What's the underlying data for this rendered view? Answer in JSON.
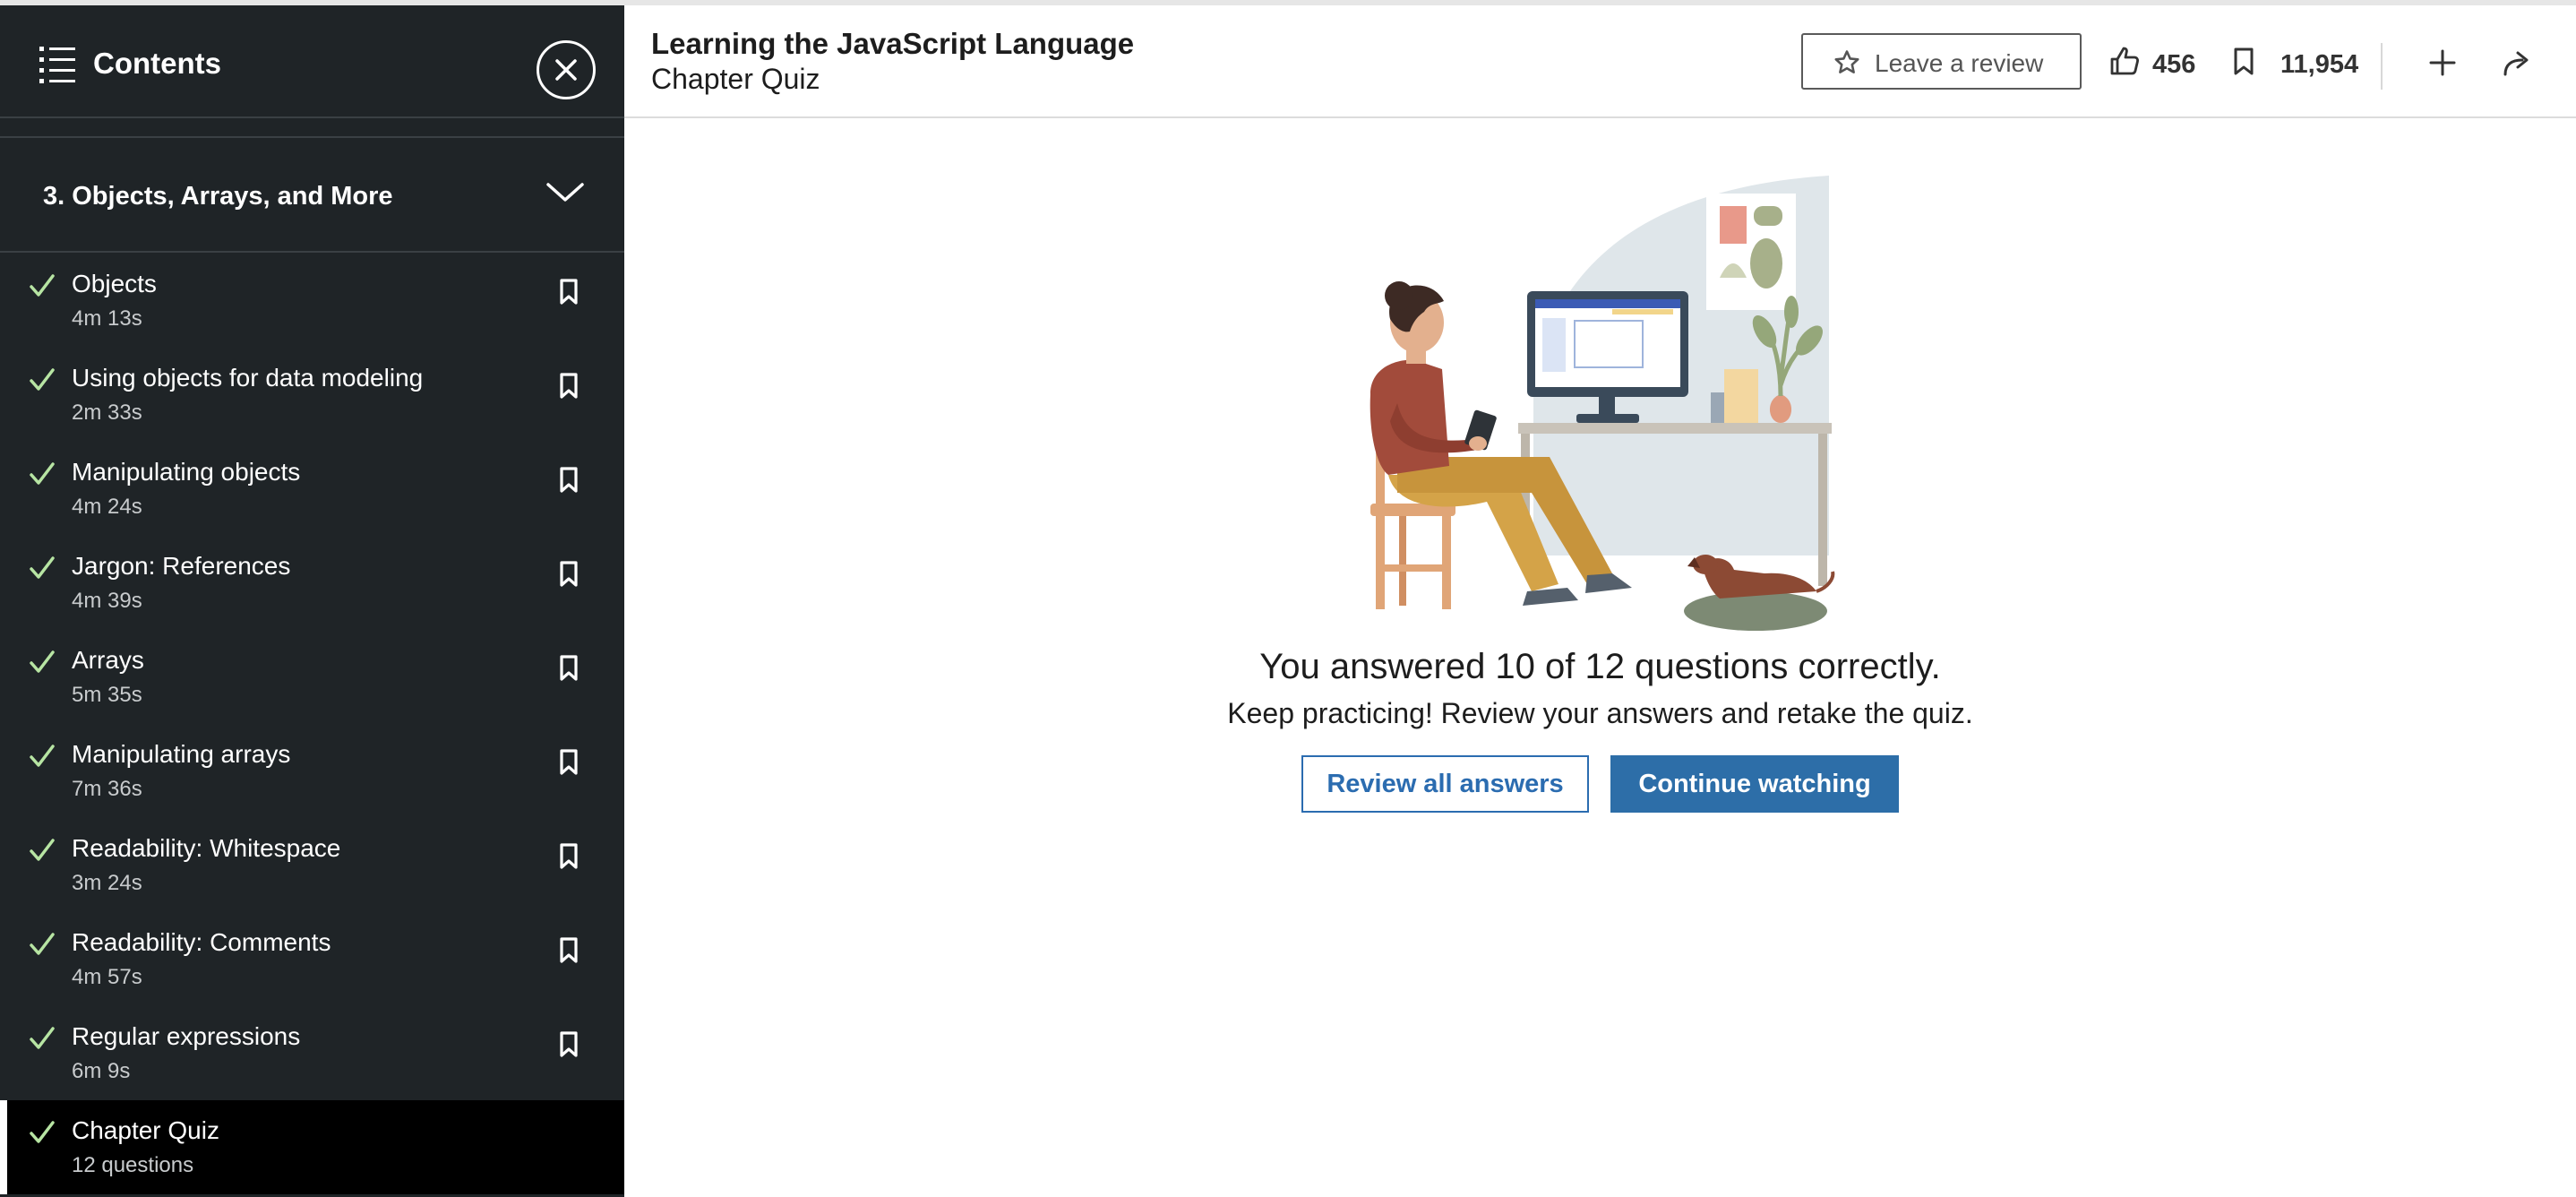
{
  "sidebar": {
    "title": "Contents",
    "chapter": {
      "title": "3. Objects, Arrays, and More"
    },
    "lessons": [
      {
        "title": "Objects",
        "duration": "4m 13s"
      },
      {
        "title": "Using objects for data modeling",
        "duration": "2m 33s"
      },
      {
        "title": "Manipulating objects",
        "duration": "4m 24s"
      },
      {
        "title": "Jargon: References",
        "duration": "4m 39s"
      },
      {
        "title": "Arrays",
        "duration": "5m 35s"
      },
      {
        "title": "Manipulating arrays",
        "duration": "7m 36s"
      },
      {
        "title": "Readability: Whitespace",
        "duration": "3m 24s"
      },
      {
        "title": "Readability: Comments",
        "duration": "4m 57s"
      },
      {
        "title": "Regular expressions",
        "duration": "6m 9s"
      },
      {
        "title": "Chapter Quiz",
        "duration": "12 questions"
      }
    ]
  },
  "header": {
    "course_title": "Learning the JavaScript Language",
    "subtitle": "Chapter Quiz",
    "review_label": "Leave a review",
    "likes": "456",
    "saves": "11,954"
  },
  "main": {
    "result": "You answered 10 of 12 questions correctly.",
    "message": "Keep practicing! Review your answers and retake the quiz.",
    "review_button": "Review all answers",
    "continue_button": "Continue watching"
  },
  "colors": {
    "sidebar_bg": "#1f2427",
    "check": "#b7e5a3",
    "primary": "#2d6ea8"
  },
  "icons": [
    "list-icon",
    "close-icon",
    "chevron-down-icon",
    "check-icon",
    "bookmark-icon",
    "star-icon",
    "thumbs-up-icon",
    "plus-icon",
    "share-icon"
  ]
}
